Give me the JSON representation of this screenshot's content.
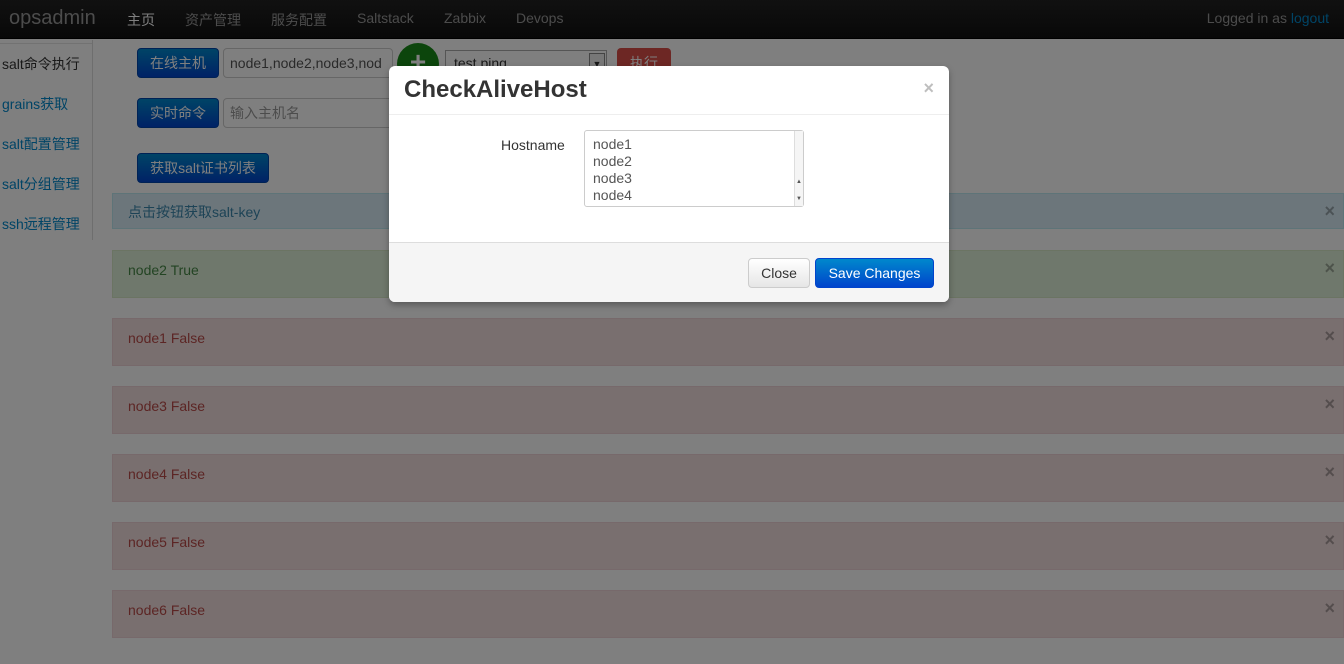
{
  "navbar": {
    "brand": "opsadmin",
    "items": [
      "主页",
      "资产管理",
      "服务配置",
      "Saltstack",
      "Zabbix",
      "Devops"
    ],
    "logged_in_text": "Logged in as",
    "logout_label": "logout"
  },
  "sidebar": {
    "items": [
      "salt命令执行",
      "grains获取",
      "salt配置管理",
      "salt分组管理",
      "ssh远程管理"
    ]
  },
  "toolbar": {
    "online_hosts_button": "在线主机",
    "host_list_value": "node1,node2,node3,nod",
    "add_icon": "plus-circle",
    "function_select_value": "test.ping",
    "execute_button": "执行",
    "realtime_command_button": "实时命令",
    "hostname_placeholder": "输入主机名",
    "get_salt_keys_button": "获取salt证书列表"
  },
  "alerts": [
    {
      "text": "点击按钮获取salt-key",
      "kind": "info"
    },
    {
      "text": "node2 True",
      "kind": "success"
    },
    {
      "text": "node1 False",
      "kind": "error"
    },
    {
      "text": "node3 False",
      "kind": "error"
    },
    {
      "text": "node4 False",
      "kind": "error"
    },
    {
      "text": "node5 False",
      "kind": "error"
    },
    {
      "text": "node6 False",
      "kind": "error"
    }
  ],
  "close_glyph": "×",
  "modal": {
    "title": "CheckAliveHost",
    "hostname_label": "Hostname",
    "hostname_lines": [
      "node1",
      "node2",
      "node3",
      "node4"
    ],
    "close_button": "Close",
    "save_button": "Save Changes"
  },
  "colors": {
    "primary": "#0044cc",
    "danger": "#da4f49",
    "success": "#198a19"
  }
}
